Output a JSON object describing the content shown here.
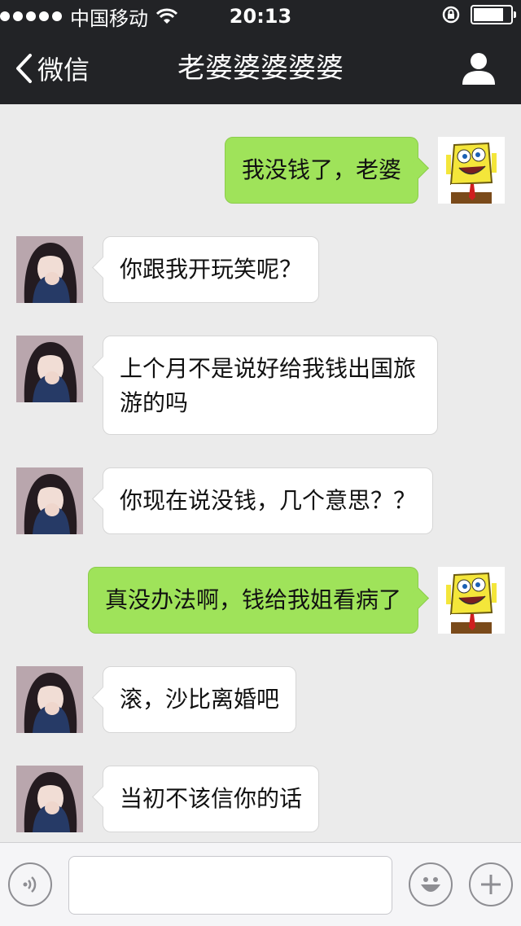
{
  "status_bar": {
    "carrier": "中国移动",
    "time": "20:13",
    "battery_level": 0.9
  },
  "nav": {
    "back_label": "微信",
    "title": "老婆婆婆婆婆"
  },
  "messages": [
    {
      "side": "out",
      "text": "我没钱了，老婆"
    },
    {
      "side": "in",
      "text": "你跟我开玩笑呢？"
    },
    {
      "side": "in",
      "text": "上个月不是说好给我钱出国旅游的吗"
    },
    {
      "side": "in",
      "text": "你现在说没钱，几个意思？？"
    },
    {
      "side": "out",
      "text": "真没办法啊，钱给我姐看病了"
    },
    {
      "side": "in",
      "text": "滚，沙比离婚吧"
    },
    {
      "side": "in",
      "text": "当初不该信你的话"
    }
  ],
  "input": {
    "value": "",
    "placeholder": ""
  },
  "icons": {
    "back": "chevron-left-icon",
    "profile": "person-icon",
    "voice": "voice-icon",
    "emoji": "emoji-icon",
    "plus": "plus-icon"
  },
  "colors": {
    "nav_bg": "#222326",
    "chat_bg": "#ebebeb",
    "outgoing_bubble": "#9fe35a",
    "incoming_bubble": "#ffffff"
  }
}
